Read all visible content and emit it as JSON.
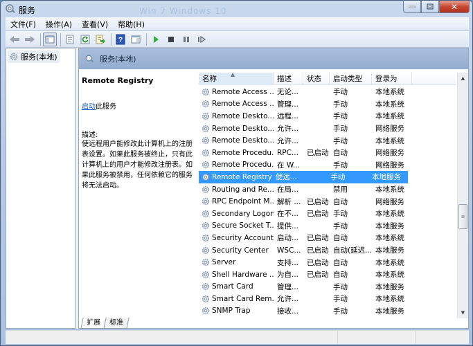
{
  "window": {
    "title": "服务",
    "ghost_title": "Win 7 Windows 10",
    "controls": [
      "minimize",
      "maximize",
      "close"
    ]
  },
  "menubar": {
    "items": [
      {
        "label": "文件(F)"
      },
      {
        "label": "操作(A)"
      },
      {
        "label": "查看(V)"
      },
      {
        "label": "帮助(H)"
      }
    ]
  },
  "toolbar": {
    "buttons": [
      {
        "icon": "back-arrow-icon"
      },
      {
        "icon": "forward-arrow-icon"
      },
      {
        "icon": "show-hide-console-tree-icon",
        "active": true
      },
      {
        "icon": "properties-icon"
      },
      {
        "icon": "refresh-icon"
      },
      {
        "icon": "export-list-icon"
      },
      {
        "icon": "help-icon"
      },
      {
        "icon": "show-hide-action-pane-icon"
      },
      {
        "icon": "start-service-icon"
      },
      {
        "icon": "stop-service-icon"
      },
      {
        "icon": "pause-service-icon"
      },
      {
        "icon": "restart-service-icon"
      }
    ]
  },
  "tree": {
    "items": [
      {
        "label": "服务(本地)"
      }
    ]
  },
  "main": {
    "header": "服务(本地)",
    "selected_service": {
      "name": "Remote Registry",
      "start_link": "启动",
      "start_suffix": "此服务",
      "desc_label": "描述:",
      "description": "使远程用户能修改此计算机上的注册表设置。如果此服务被终止，只有此计算机上的用户才能修改注册表。如果此服务被禁用，任何依赖它的服务将无法启动。"
    },
    "columns": {
      "name": "名称",
      "desc": "描述",
      "status": "状态",
      "startup_type": "启动类型",
      "logon_as": "登录为"
    },
    "sorted_column": "name",
    "rows": [
      {
        "name": "Remote Access ...",
        "desc": "无论...",
        "status": "",
        "type": "手动",
        "logon": "本地系统"
      },
      {
        "name": "Remote Access ...",
        "desc": "管理...",
        "status": "",
        "type": "手动",
        "logon": "本地系统"
      },
      {
        "name": "Remote Deskto...",
        "desc": "远程...",
        "status": "",
        "type": "手动",
        "logon": "本地系统"
      },
      {
        "name": "Remote Deskto...",
        "desc": "允许...",
        "status": "",
        "type": "手动",
        "logon": "网络服务"
      },
      {
        "name": "Remote Deskto...",
        "desc": "允许...",
        "status": "",
        "type": "手动",
        "logon": "本地系统"
      },
      {
        "name": "Remote Procedu...",
        "desc": "RPC...",
        "status": "已启动",
        "type": "自动",
        "logon": "网络服务"
      },
      {
        "name": "Remote Procedu...",
        "desc": "在 W...",
        "status": "",
        "type": "手动",
        "logon": "网络服务"
      },
      {
        "name": "Remote Registry",
        "desc": "使远...",
        "status": "",
        "type": "手动",
        "logon": "本地服务",
        "selected": true
      },
      {
        "name": "Routing and Re...",
        "desc": "在局...",
        "status": "",
        "type": "禁用",
        "logon": "本地系统"
      },
      {
        "name": "RPC Endpoint M...",
        "desc": "解析 ...",
        "status": "已启动",
        "type": "自动",
        "logon": "网络服务"
      },
      {
        "name": "Secondary Logon",
        "desc": "在不...",
        "status": "已启动",
        "type": "手动",
        "logon": "本地系统"
      },
      {
        "name": "Secure Socket T...",
        "desc": "提供...",
        "status": "",
        "type": "手动",
        "logon": "本地服务"
      },
      {
        "name": "Security Account...",
        "desc": "启动...",
        "status": "已启动",
        "type": "自动",
        "logon": "本地系统"
      },
      {
        "name": "Security Center",
        "desc": "WSC...",
        "status": "已启动",
        "type": "自动(延迟...",
        "logon": "本地服务"
      },
      {
        "name": "Server",
        "desc": "支持...",
        "status": "已启动",
        "type": "自动",
        "logon": "本地系统"
      },
      {
        "name": "Shell Hardware ...",
        "desc": "为自...",
        "status": "已启动",
        "type": "自动",
        "logon": "本地系统"
      },
      {
        "name": "Smart Card",
        "desc": "管理...",
        "status": "",
        "type": "手动",
        "logon": "本地服务"
      },
      {
        "name": "Smart Card Rem...",
        "desc": "允许...",
        "status": "",
        "type": "手动",
        "logon": "本地系统"
      },
      {
        "name": "SNMP Trap",
        "desc": "接收...",
        "status": "",
        "type": "手动",
        "logon": "本地服务"
      }
    ],
    "tabs": [
      {
        "label": "扩展",
        "active": true
      },
      {
        "label": "标准",
        "active": false
      }
    ]
  },
  "colors": {
    "selection": "#3399ff",
    "header_band": "#93acd0",
    "link": "#1a5dad"
  }
}
